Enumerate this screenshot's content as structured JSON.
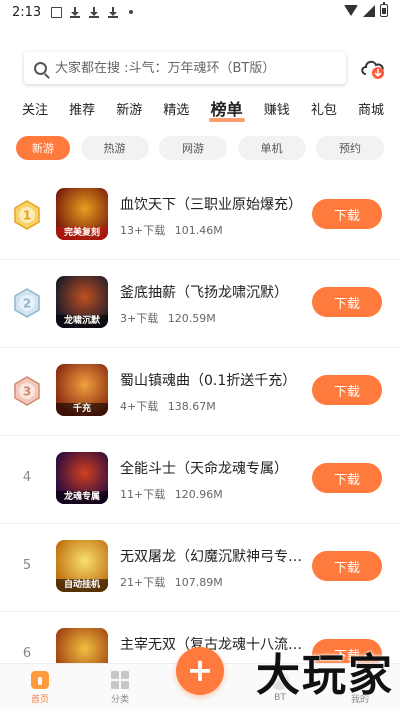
{
  "status_bar": {
    "time": "2:13"
  },
  "search": {
    "placeholder": "大家都在搜 :斗气：万年魂环（BT版）"
  },
  "top_tabs": [
    "关注",
    "推荐",
    "新游",
    "精选",
    "榜单",
    "赚钱",
    "礼包",
    "商城"
  ],
  "active_top_tab": "榜单",
  "sub_tabs": [
    "新游",
    "热游",
    "网游",
    "单机",
    "预约"
  ],
  "active_sub_tab": "新游",
  "download_label": "下载",
  "games": [
    {
      "rank": "1",
      "title": "血饮天下（三职业原始爆充）",
      "downloads": "13+下载",
      "size": "101.46M",
      "thumb_caption": "完美复刻",
      "colors": [
        "#7a1a0a",
        "#e8a020"
      ]
    },
    {
      "rank": "2",
      "title": "釜底抽薪（飞扬龙啸沉默）",
      "downloads": "3+下载",
      "size": "120.59M",
      "thumb_caption": "龙啸沉默",
      "colors": [
        "#1a1a2a",
        "#c05020"
      ]
    },
    {
      "rank": "3",
      "title": "蜀山镇魂曲（0.1折送千充）",
      "downloads": "4+下载",
      "size": "138.67M",
      "thumb_caption": "千充",
      "colors": [
        "#8a2a10",
        "#f0a040"
      ]
    },
    {
      "rank": "4",
      "title": "全能斗士（天命龙魂专属）",
      "downloads": "11+下载",
      "size": "120.96M",
      "thumb_caption": "龙魂专属",
      "colors": [
        "#2a0a40",
        "#d04020"
      ]
    },
    {
      "rank": "5",
      "title": "无双屠龙（幻魔沉默神弓专属）",
      "downloads": "21+下载",
      "size": "107.89M",
      "thumb_caption": "自动挂机",
      "colors": [
        "#c07010",
        "#f8e070"
      ]
    },
    {
      "rank": "6",
      "title": "主宰无双（复古龙魂十八流派）",
      "downloads": "",
      "size": "",
      "thumb_caption": "",
      "colors": [
        "#a04010",
        "#f0c040"
      ]
    }
  ],
  "bottom_nav": [
    {
      "label": "首页",
      "icon": "home-icon"
    },
    {
      "label": "分类",
      "icon": "category-icon"
    },
    {
      "label": "BT",
      "icon": "bt-icon"
    },
    {
      "label": "我的",
      "icon": "profile-icon"
    }
  ],
  "plus_label": "+",
  "watermark": "大玩家",
  "colors": {
    "accent": "#ff7a3d"
  }
}
